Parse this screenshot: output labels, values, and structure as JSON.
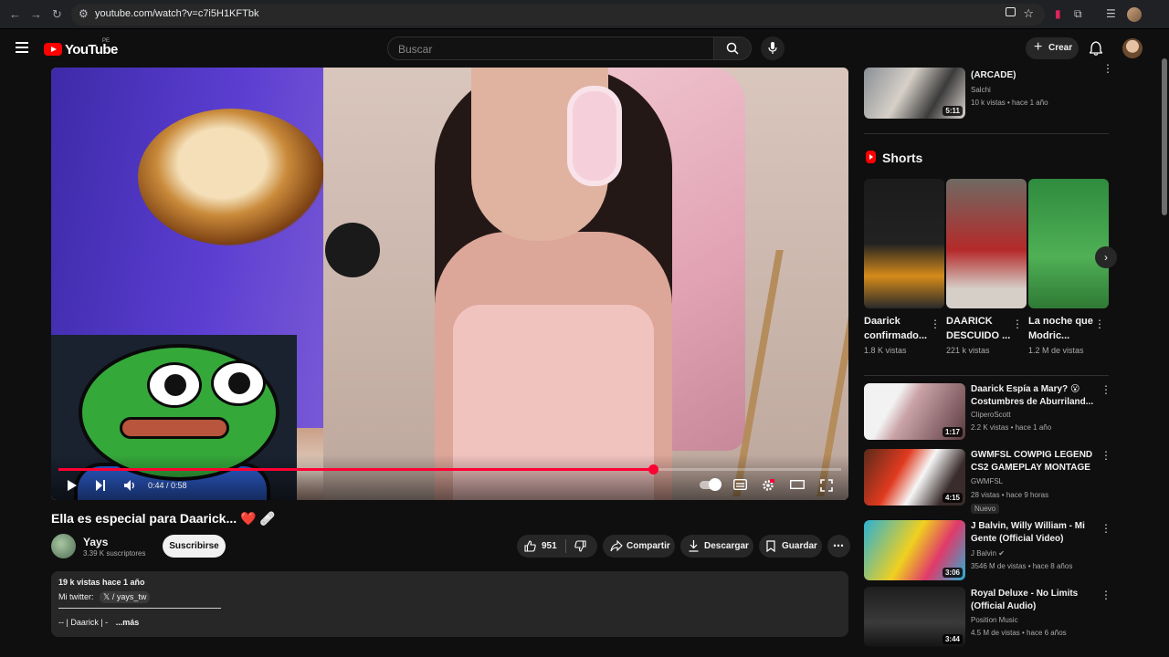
{
  "browser": {
    "url": "youtube.com/watch?v=c7i5H1KFTbk"
  },
  "header": {
    "logo_text": "YouTube",
    "region": "PE",
    "search_placeholder": "Buscar",
    "create_label": "Crear"
  },
  "player": {
    "progress_fraction": 0.76,
    "time": "0:44 / 0:58"
  },
  "video": {
    "title": "Ella es especial para Daarick... ❤️ 🩹",
    "channel": "Yays",
    "subscribers": "3.39 K suscriptores",
    "subscribe_label": "Suscribirse",
    "likes": "951",
    "share_label": "Compartir",
    "download_label": "Descargar",
    "save_label": "Guardar"
  },
  "description": {
    "meta": "19 k vistas  hace 1 año",
    "twitter_prefix": "Mi twitter:",
    "twitter_handle": "/ yays_tw",
    "line3": "-- | Daarick | -",
    "more": "...más"
  },
  "sidebar": {
    "top_item": {
      "title": "(ARCADE)",
      "channel": "Salchi",
      "meta": "10 k vistas • hace 1 año",
      "duration": "5:11"
    },
    "shorts_heading": "Shorts",
    "shorts": [
      {
        "title": "Daarick confirmado...",
        "views": "1.8 K vistas"
      },
      {
        "title": "DAARICK DESCUIDO ...",
        "views": "221 k vistas"
      },
      {
        "title": "La noche que Modric...",
        "views": "1.2 M de vistas"
      }
    ],
    "videos": [
      {
        "title": "Daarick Espía a Mary? 😮 Costumbres de Aburriland...",
        "channel": "CliperoScott",
        "meta": "2.2 K vistas • hace 1 año",
        "duration": "1:17"
      },
      {
        "title": "GWMFSL COWPIG LEGEND CS2 GAMEPLAY MONTAGE",
        "channel": "GWMFSL",
        "meta": "28 vistas • hace 9 horas",
        "duration": "4:15",
        "badge": "Nuevo"
      },
      {
        "title": "J Balvin, Willy William - Mi Gente (Official Video)",
        "channel": "J Balvin ✔",
        "meta": "3546 M de vistas • hace 8 años",
        "duration": "3:06"
      },
      {
        "title": "Royal Deluxe - No Limits (Official Audio)",
        "channel": "Position Music",
        "meta": "4.5 M de vistas • hace 6 años",
        "duration": "3:44"
      }
    ]
  },
  "colors": {
    "background": "#0f0f0f",
    "accent": "#ff0033",
    "pill": "#272727"
  }
}
